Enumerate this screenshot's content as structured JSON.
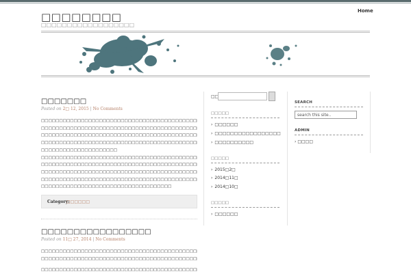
{
  "site": {
    "title": "□□□□□□□□",
    "description": "□□□□□□□□□□□□□□□□□□"
  },
  "nav": {
    "home": "Home"
  },
  "posts": [
    {
      "title": "□□□□□□□",
      "meta_posted": "Posted on",
      "date": "2□ 12, 2015",
      "comments": "No Comments",
      "paragraphs": [
        "□□□□□□□□□□□□□□□□□□□□□□□□□□□□□□□□□□□□□□□□□□□□□□□□□□□□□□",
        "□□□□□□□□□□□□□□□□□□□□□□□□□□□□□□□□□□□□□□□□□□□□□□□□□□",
        "□□□□□□□□□□□□□□□□□□□□□□□□□□□□□□□□□□□□□□□□□□□□□□□□□□□□□□",
        "□□□□□□□□□□□□□□□□□□□□□□□□□□□□□□□□□□□□□□□□□□□□□□□□□□□□□□",
        "□□□□□□□□□□□□□□□□□□□□□",
        "□□□□□□□□□□□□□□□□□□□□□□□□□□□□□□□□□□□□□□□□□□□□□□□□□□□□□□",
        "□□□□□□□□□□□□□□□□□□□□□□□□□□□□□□□□□□□□□□□□□□□□□□□□□□□□□□",
        "□□□□□□□□□□□□□□□□□□□□□□□□□□□□□□□□□□□□□□□□□□□□□□□□□□□□□□",
        "□□□□□□□□□□□□□□□□□□□□□□□□□□□□□□□□□□□□□□□□□□□□□",
        "□□□□□□□□□□□□□□□□□□□□□□□□□□□□□□□□□□□□"
      ],
      "category_label": "Category:",
      "category": "□□□□□□"
    },
    {
      "title": "□□□□□□□□□□□□□□□□□",
      "meta_posted": "Posted on",
      "date": "11□ 27, 2014",
      "comments": "No Comments",
      "paragraphs": [
        "□□□□□□□□□□□□□□□□□□□□□□□□□□□□□□□□□□□□□□□□□□□□□□□□□□□□□□",
        "□□□□□□□□□□□□□□□□□□□□□□□□□□□□□□□□□□□□□□□□□□□□",
        "□□□□□□□□□□□□□□□□□□□□□□□□□□□□□□□□□□□□□□□□□□□□□□□□□□□□□□"
      ]
    }
  ],
  "sidebar1": {
    "search_label": "□□",
    "categories_title": "□□□□□",
    "categories": [
      "□□□□□□",
      "□□□□□□□□□□□□□□□□□",
      "□□□□□□□□□□"
    ],
    "archives_title": "□□□□□",
    "archives": [
      "2015□2□",
      "2014□11□",
      "2014□10□"
    ],
    "meta_title": "□□□□□",
    "meta_items": [
      "□□□□□□"
    ]
  },
  "sidebar2": {
    "search_title": "SEARCH",
    "search_placeholder": "search this site..",
    "admin_title": "ADMIN",
    "admin_items": [
      "□□□□"
    ]
  }
}
